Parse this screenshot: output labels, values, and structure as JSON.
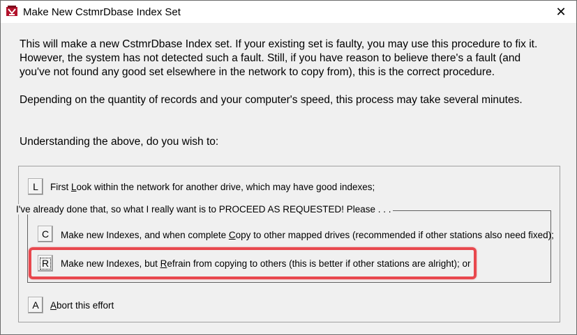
{
  "window": {
    "title": "Make New CstmrDbase Index Set",
    "close_glyph": "✕",
    "icon": "app-icon"
  },
  "body": {
    "paragraph1": "This will make a new CstmrDbase Index set.  If your existing set is faulty, you may use this procedure to fix it.  However, the system has not detected such a fault.  Still, if you have reason to believe there's a fault (and you've not found any good set elsewhere in the network to copy from), this is the correct procedure.",
    "paragraph2": "Depending on the quantity of records and your computer's speed, this process may take several minutes.",
    "paragraph3": "Understanding the above, do you wish to:"
  },
  "options": {
    "look": {
      "key": "L",
      "pre": "First ",
      "ul": "L",
      "post": "ook within the network for another drive, which may have good indexes;"
    },
    "group_label": "I've already done that, so what I really want is to PROCEED AS REQUESTED!  Please . . .",
    "copy": {
      "key": "C",
      "pre": "Make new Indexes, and when complete ",
      "ul": "C",
      "post": "opy to other mapped drives (recommended if other stations also need fixed);"
    },
    "refrain": {
      "key": "R",
      "pre": "Make new Indexes, but ",
      "ul": "R",
      "post": "efrain from copying to others (this is better if other stations are alright); or"
    },
    "abort": {
      "key": "A",
      "pre": "",
      "ul": "A",
      "post": "bort this effort"
    }
  },
  "colors": {
    "highlight": "#e8484e",
    "window_bg": "#f0f0f0"
  }
}
